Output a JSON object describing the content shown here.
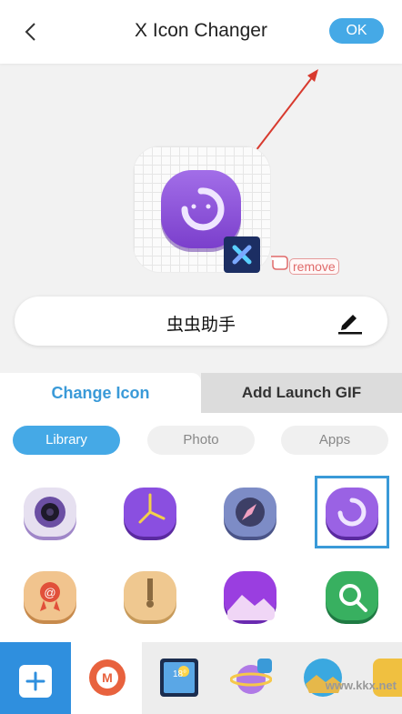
{
  "header": {
    "title": "X Icon Changer",
    "ok_label": "OK"
  },
  "preview": {
    "remove_label": "remove",
    "app_name": "虫虫助手"
  },
  "tabs": [
    {
      "label": "Change Icon"
    },
    {
      "label": "Add Launch GIF"
    }
  ],
  "filters": [
    {
      "label": "Library"
    },
    {
      "label": "Photo"
    },
    {
      "label": "Apps"
    }
  ],
  "library_icons": [
    "camera-lens-icon",
    "clock-icon",
    "compass-icon",
    "smiley-ring-icon",
    "email-badge-icon",
    "zipper-icon",
    "mountain-image-icon",
    "android-search-icon"
  ],
  "tray_icons": [
    "music-icon",
    "weather-icon",
    "planet-icon",
    "landscape-icon"
  ],
  "watermark": "www.kkx.net",
  "colors": {
    "accent": "#45a9e6",
    "selected_border": "#3a9ad8"
  }
}
